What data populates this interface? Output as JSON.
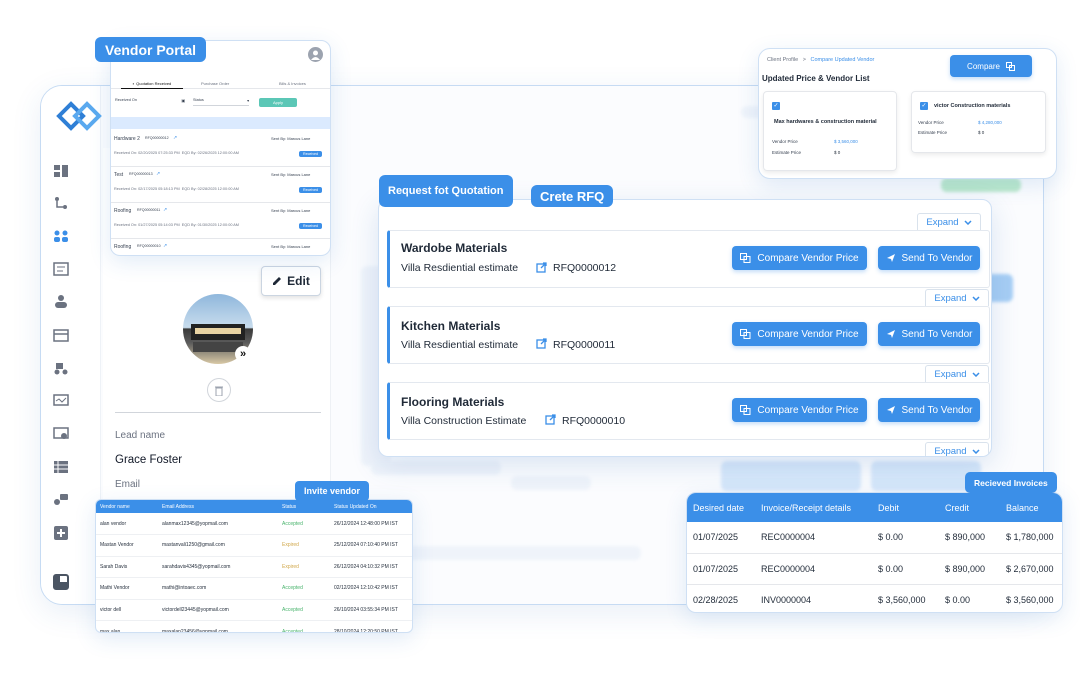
{
  "vendor_portal": {
    "title": "Vendor Portal",
    "tabs": [
      "Quotation Received",
      "Purchase Order",
      "Bills & Invoices"
    ],
    "filters": {
      "received_on": "Received On",
      "status": "Status",
      "apply": "Apply"
    },
    "rows": [
      {
        "name": "Hardware 2",
        "rfq": "RFQ00000012",
        "sent_by": "Sent By: Marcus Lane",
        "received": "02/20/2025 07:25:33 PM",
        "eqd": "02/26/2025 12:00:00 AM",
        "status": "Received"
      },
      {
        "name": "Test",
        "rfq": "RFQ00000013",
        "sent_by": "Sent By: Marcus Lane",
        "received": "02/17/2025 05:18:13 PM",
        "eqd": "02/28/2025 12:00:00 AM",
        "status": "Received"
      },
      {
        "name": "Roofing",
        "rfq": "RFQ00000011",
        "sent_by": "Sent By: Marcus Lane",
        "received": "01/27/2025 05:14:03 PM",
        "eqd": "01/30/2025 12:00:00 AM",
        "status": "Received"
      },
      {
        "name": "Roofing",
        "rfq": "RFQ00000010",
        "sent_by": "Sent By: Marcus Lane",
        "received": "",
        "eqd": "",
        "status": ""
      }
    ]
  },
  "compare_card": {
    "breadcrumb_1": "Client Profile",
    "breadcrumb_sep": ">",
    "breadcrumb_2": "Compare Updated Vendor",
    "title": "Updated Price & Vendor List",
    "compare_button": "Compare",
    "vendors": [
      {
        "name": "Max hardwares & construction material",
        "vendor_price_label": "Vendor Price",
        "vendor_price": "$ 3,560,000",
        "estimate_label": "Estimate Price",
        "estimate": "$ 0"
      },
      {
        "name": "victor Construction materials",
        "vendor_price_label": "Vendor Price",
        "vendor_price": "$ 4,280,000",
        "estimate_label": "Estimate Price",
        "estimate": "$ 0"
      }
    ]
  },
  "rfq_panel": {
    "label_request": "Request fot Quotation",
    "label_create": "Crete RFQ",
    "expand_label": "Expand",
    "compare_label": "Compare Vendor Price",
    "send_label": "Send To Vendor",
    "items": [
      {
        "title": "Wardobe Materials",
        "estimate": "Villa Resdiential estimate",
        "rfq": "RFQ0000012"
      },
      {
        "title": "Kitchen Materials",
        "estimate": "Villa Resdiential estimate",
        "rfq": "RFQ0000011"
      },
      {
        "title": "Flooring Materials",
        "estimate": "Villa Construction Estimate",
        "rfq": "RFQ0000010"
      }
    ]
  },
  "lead": {
    "edit_label": "Edit",
    "lead_name_label": "Lead name",
    "lead_name": "Grace Foster",
    "email_label": "Email"
  },
  "invite_vendor": {
    "label": "Invite vendor",
    "headers": [
      "Vendor name",
      "Email Address",
      "Status",
      "Status Updated On"
    ],
    "rows": [
      [
        "alan vendor",
        "alanmax12345@yopmail.com",
        "Accepted",
        "26/12/2024 12:48:00 PM IST"
      ],
      [
        "Mastan Vendor",
        "mastanvali1250@gmail.com",
        "Expired",
        "25/12/2024 07:10:40 PM IST"
      ],
      [
        "Sarah Davis",
        "sarahdavis4345@yopmail.com",
        "Expired",
        "26/12/2024 04:10:32 PM IST"
      ],
      [
        "Mathi Vendor",
        "mathi@intoaec.com",
        "Accepted",
        "02/12/2024 12:10:42 PM IST"
      ],
      [
        "victor dell",
        "victordell23445@yopmail.com",
        "Accepted",
        "26/10/2024 03:55:34 PM IST"
      ],
      [
        "max alan",
        "maxalan23456@yopmail.com",
        "Accepted",
        "28/10/2024 12:20:50 PM IST"
      ]
    ]
  },
  "invoices": {
    "label": "Recieved Invoices",
    "headers": [
      "Desired date",
      "Invoice/Receipt details",
      "Debit",
      "Credit",
      "Balance"
    ],
    "rows": [
      [
        "01/07/2025",
        "REC0000004",
        "$ 0.00",
        "$ 890,000",
        "$ 1,780,000"
      ],
      [
        "01/07/2025",
        "REC0000004",
        "$ 0.00",
        "$ 890,000",
        "$ 2,670,000"
      ],
      [
        "02/28/2025",
        "INV0000004",
        "$ 3,560,000",
        "$ 0.00",
        "$ 3,560,000"
      ]
    ]
  },
  "colors": {
    "accent": "#3b8fe8",
    "accepted": "#47b36b",
    "expired": "#d1a84b"
  }
}
